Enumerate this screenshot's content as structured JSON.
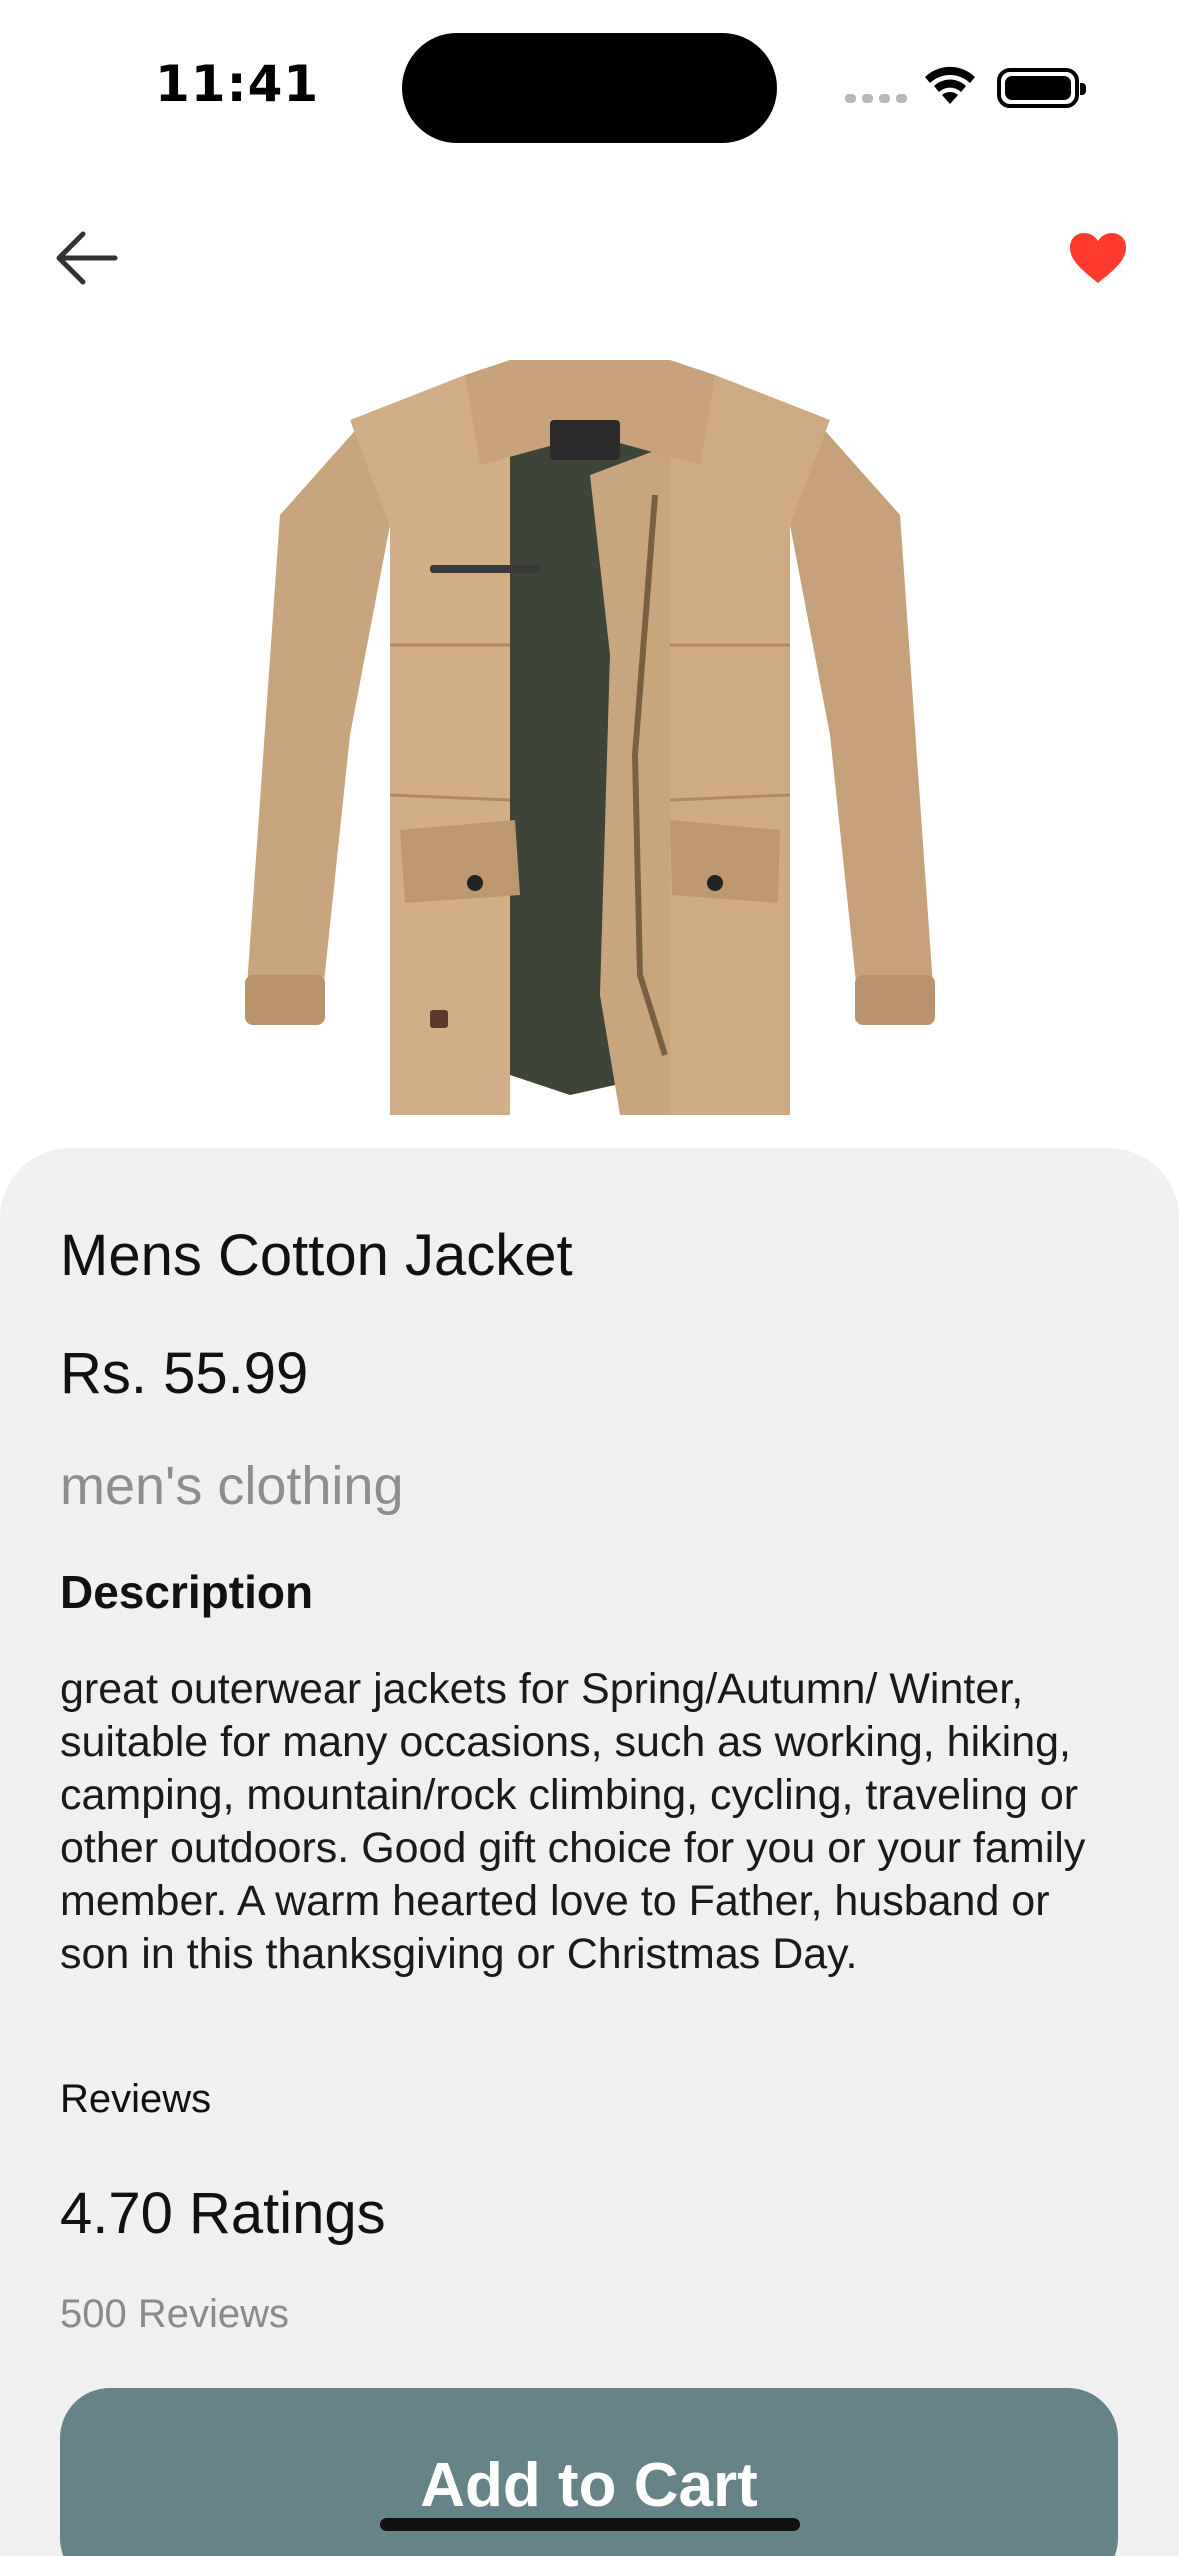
{
  "status_bar": {
    "time": "11:41"
  },
  "nav": {
    "back_icon": "arrow-left-icon",
    "favorite_icon": "heart-icon",
    "favorite_color": "#ff3b30"
  },
  "product": {
    "image_icon": "jacket-image",
    "title": "Mens Cotton Jacket",
    "price": "Rs. 55.99",
    "category": "men's clothing",
    "description_heading": "Description",
    "description": "great outerwear jackets for Spring/Autumn/ Winter, suitable for many occasions, such as working, hiking, camping, mountain/rock climbing, cycling, traveling or other outdoors. Good gift choice for you or your family member. A warm hearted love to Father, husband or son in this thanksgiving or Christmas Day.",
    "reviews_heading": "Reviews",
    "ratings": "4.70 Ratings",
    "review_count": "500 Reviews"
  },
  "actions": {
    "add_to_cart": "Add to Cart",
    "button_color": "#668388"
  }
}
